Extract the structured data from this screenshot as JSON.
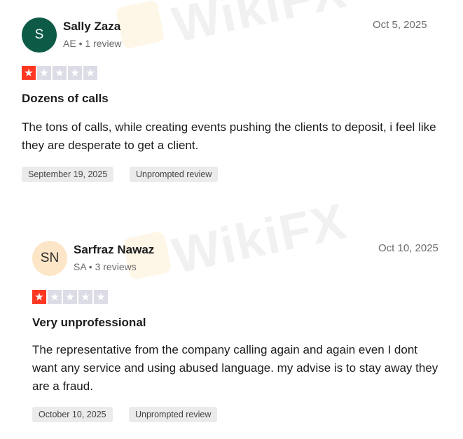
{
  "watermark": "WikiFX",
  "reviews": [
    {
      "initials": "S",
      "name": "Sally Zaza",
      "meta": "AE • 1 review",
      "date": "Oct 5, 2025",
      "rating": 1,
      "max_rating": 5,
      "title": "Dozens of calls",
      "body": "The tons of calls, while creating events pushing the clients to deposit, i feel like they are desperate to get a client.",
      "experience_date": "September 19, 2025",
      "tag": "Unprompted review",
      "avatar_bg": "#0d5b47",
      "avatar_fg": "#ffffff"
    },
    {
      "initials": "SN",
      "name": "Sarfraz Nawaz",
      "meta": "SA • 3 reviews",
      "date": "Oct 10, 2025",
      "rating": 1,
      "max_rating": 5,
      "title": "Very unprofessional",
      "body": "The representative from the company calling again and again even I dont want any service and using abused language. my advise is to stay away they are a fraud.",
      "experience_date": "October 10, 2025",
      "tag": "Unprompted review",
      "avatar_bg": "#fde6c7",
      "avatar_fg": "#2b2b2b"
    }
  ],
  "colors": {
    "star_on": "#ff3722",
    "star_off": "#dcdce6"
  }
}
